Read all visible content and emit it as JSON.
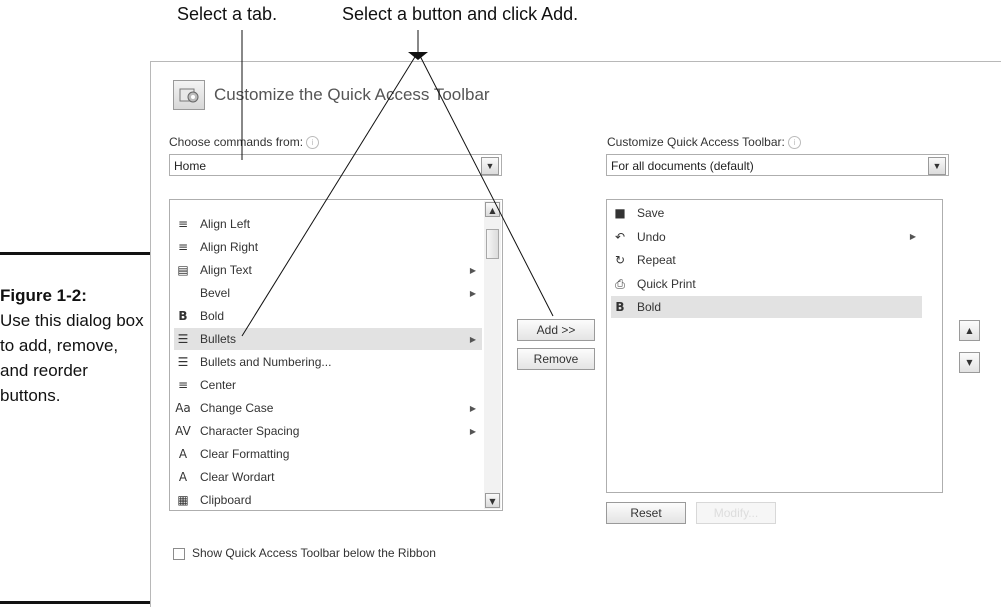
{
  "callouts": {
    "select_tab": "Select a tab.",
    "select_button": "Select a button and click Add."
  },
  "figure": {
    "number": "Figure 1-2:",
    "caption": "Use this dialog box to add, remove, and reorder buttons."
  },
  "dialog": {
    "title": "Customize the Quick Access Toolbar",
    "choose_label": "Choose commands from:",
    "choose_value": "Home",
    "customize_label": "Customize Quick Access Toolbar:",
    "customize_value": "For all documents (default)",
    "commands": [
      {
        "label": "Align Left",
        "icon": "align-left-icon",
        "glyph": "≡",
        "submenu": false
      },
      {
        "label": "Align Right",
        "icon": "align-right-icon",
        "glyph": "≡",
        "submenu": false
      },
      {
        "label": "Align Text",
        "icon": "align-text-icon",
        "glyph": "▤",
        "submenu": true
      },
      {
        "label": "Bevel",
        "icon": "bevel-icon",
        "glyph": "",
        "submenu": true
      },
      {
        "label": "Bold",
        "icon": "bold-icon",
        "glyph": "B",
        "submenu": false
      },
      {
        "label": "Bullets",
        "icon": "bullets-icon",
        "glyph": "☰",
        "submenu": true,
        "selected": true
      },
      {
        "label": "Bullets and Numbering...",
        "icon": "bullets-numbering-icon",
        "glyph": "☰",
        "submenu": false
      },
      {
        "label": "Center",
        "icon": "center-icon",
        "glyph": "≡",
        "submenu": false
      },
      {
        "label": "Change Case",
        "icon": "change-case-icon",
        "glyph": "Aa",
        "submenu": true
      },
      {
        "label": "Character Spacing",
        "icon": "character-spacing-icon",
        "glyph": "AV",
        "submenu": true
      },
      {
        "label": "Clear Formatting",
        "icon": "clear-formatting-icon",
        "glyph": "A",
        "submenu": false
      },
      {
        "label": "Clear Wordart",
        "icon": "clear-wordart-icon",
        "glyph": "A",
        "submenu": false
      },
      {
        "label": "Clipboard",
        "icon": "clipboard-icon",
        "glyph": "▦",
        "submenu": false
      }
    ],
    "toolbar_items": [
      {
        "label": "Save",
        "icon": "save-icon",
        "glyph": "■",
        "submenu": false
      },
      {
        "label": "Undo",
        "icon": "undo-icon",
        "glyph": "↶",
        "submenu": true
      },
      {
        "label": "Repeat",
        "icon": "repeat-icon",
        "glyph": "↻",
        "submenu": false
      },
      {
        "label": "Quick Print",
        "icon": "quick-print-icon",
        "glyph": "⎙",
        "submenu": false
      },
      {
        "label": "Bold",
        "icon": "bold-icon",
        "glyph": "B",
        "submenu": false,
        "selected": true
      }
    ],
    "add_button": "Add >>",
    "remove_button": "Remove",
    "reset_button": "Reset",
    "modify_button": "Modify...",
    "show_below_label": "Show Quick Access Toolbar below the Ribbon",
    "show_below_checked": false
  }
}
